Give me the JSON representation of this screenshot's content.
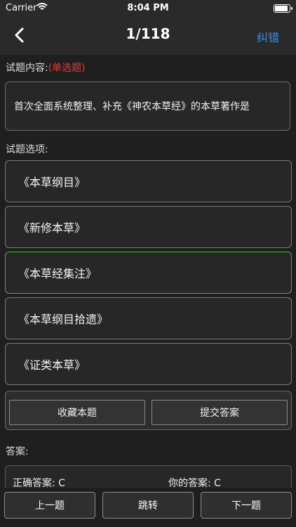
{
  "status_bar": {
    "carrier": "Carrier",
    "time": "8:04 PM"
  },
  "nav": {
    "title": "1/118",
    "report_label": "纠错"
  },
  "question": {
    "label": "试题内容:",
    "type_tag": "(单选题)",
    "text": "首次全面系统整理、补充《神农本草经》的本草著作是"
  },
  "options_label": "试题选项:",
  "options": [
    {
      "text": "《本草纲目》"
    },
    {
      "text": "《新修本草》"
    },
    {
      "text": "《本草经集注》"
    },
    {
      "text": "《本草纲目拾遗》"
    },
    {
      "text": "《证类本草》"
    }
  ],
  "selected_option_index": 2,
  "actions": {
    "favorite_label": "收藏本题",
    "submit_label": "提交答案"
  },
  "answer": {
    "label": "答案:",
    "correct_label": "正确答案:",
    "correct_value": "C",
    "yours_label": "你的答案:",
    "yours_value": "C"
  },
  "bottom": {
    "prev_label": "上一题",
    "jump_label": "跳转",
    "next_label": "下一题"
  },
  "colors": {
    "accent": "#2f8cff",
    "tag": "#e23a3a",
    "selected_border": "#53a84c"
  }
}
